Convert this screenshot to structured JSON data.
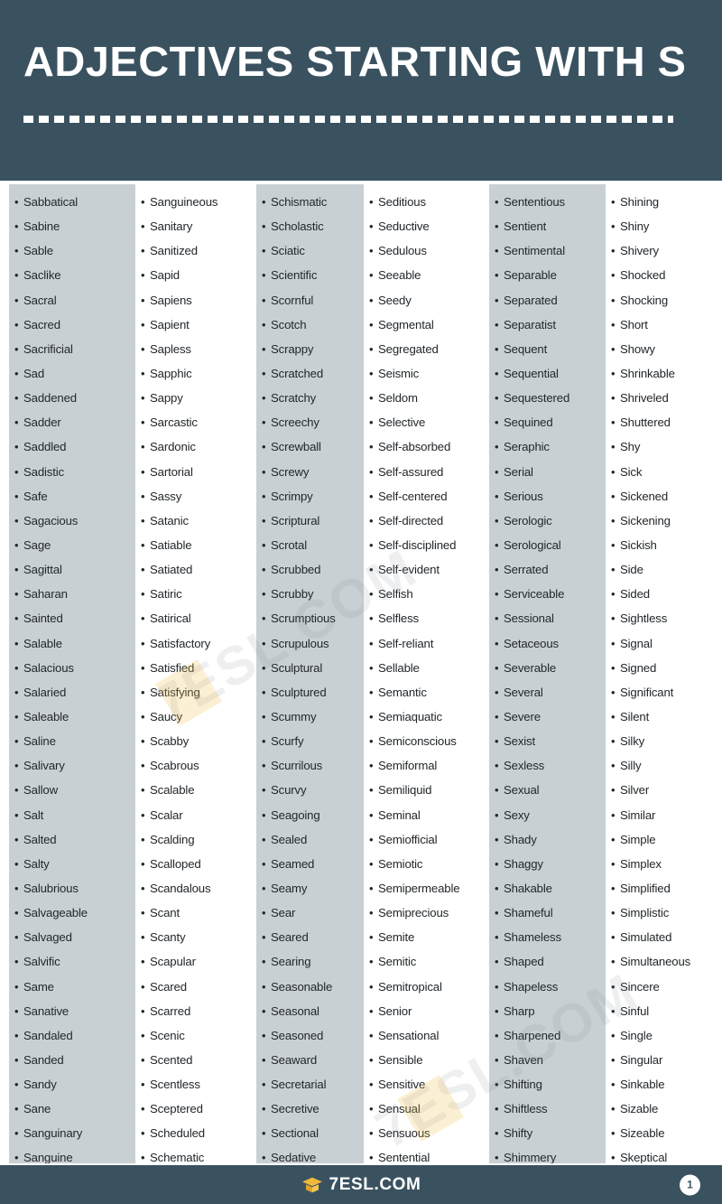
{
  "header": {
    "title": "ADJECTIVES STARTING WITH S",
    "divider": "dashed-rule",
    "background_color": "#3a5260",
    "text_color": "#ffffff"
  },
  "colors": {
    "header_bg": "#3a5260",
    "footer_bg": "#3a5260",
    "shaded_column_bg": "#c9d0d4",
    "plain_column_bg": "#ffffff",
    "word_text": "#22272b",
    "logo_accent": "#f0b93c"
  },
  "columns": [
    {
      "index": 1,
      "shaded": true,
      "words": [
        "Sabbatical",
        "Sabine",
        "Sable",
        "Saclike",
        "Sacral",
        "Sacred",
        "Sacrificial",
        "Sad",
        "Saddened",
        "Sadder",
        "Saddled",
        "Sadistic",
        "Safe",
        "Sagacious",
        "Sage",
        "Sagittal",
        "Saharan",
        "Sainted",
        "Salable",
        "Salacious",
        "Salaried",
        "Saleable",
        "Saline",
        "Salivary",
        "Sallow",
        "Salt",
        "Salted",
        "Salty",
        "Salubrious",
        "Salvageable",
        "Salvaged",
        "Salvific",
        "Same",
        "Sanative",
        "Sandaled",
        "Sanded",
        "Sandy",
        "Sane",
        "Sanguinary",
        "Sanguine"
      ]
    },
    {
      "index": 2,
      "shaded": false,
      "words": [
        "Sanguineous",
        "Sanitary",
        "Sanitized",
        "Sapid",
        "Sapiens",
        "Sapient",
        "Sapless",
        "Sapphic",
        "Sappy",
        "Sarcastic",
        "Sardonic",
        "Sartorial",
        "Sassy",
        "Satanic",
        "Satiable",
        "Satiated",
        "Satiric",
        "Satirical",
        "Satisfactory",
        "Satisfied",
        "Satisfying",
        "Saucy",
        "Scabby",
        "Scabrous",
        "Scalable",
        "Scalar",
        "Scalding",
        "Scalloped",
        "Scandalous",
        "Scant",
        "Scanty",
        "Scapular",
        "Scared",
        "Scarred",
        "Scenic",
        "Scented",
        "Scentless",
        "Sceptered",
        "Scheduled",
        "Schematic"
      ]
    },
    {
      "index": 3,
      "shaded": true,
      "words": [
        "Schismatic",
        "Scholastic",
        "Sciatic",
        "Scientific",
        "Scornful",
        "Scotch",
        "Scrappy",
        "Scratched",
        "Scratchy",
        "Screechy",
        "Screwball",
        "Screwy",
        "Scrimpy",
        "Scriptural",
        "Scrotal",
        "Scrubbed",
        "Scrubby",
        "Scrumptious",
        "Scrupulous",
        "Sculptural",
        "Sculptured",
        "Scummy",
        "Scurfy",
        "Scurrilous",
        "Scurvy",
        "Seagoing",
        "Sealed",
        "Seamed",
        "Seamy",
        "Sear",
        "Seared",
        "Searing",
        "Seasonable",
        "Seasonal",
        "Seasoned",
        "Seaward",
        "Secretarial",
        "Secretive",
        "Sectional",
        "Sedative"
      ]
    },
    {
      "index": 4,
      "shaded": false,
      "words": [
        "Seditious",
        "Seductive",
        "Sedulous",
        "Seeable",
        "Seedy",
        "Segmental",
        "Segregated",
        "Seismic",
        "Seldom",
        "Selective",
        "Self-absorbed",
        "Self-assured",
        "Self-centered",
        "Self-directed",
        "Self-disciplined",
        "Self-evident",
        "Selfish",
        "Selfless",
        "Self-reliant",
        "Sellable",
        "Semantic",
        "Semiaquatic",
        "Semiconscious",
        "Semiformal",
        "Semiliquid",
        "Seminal",
        "Semiofficial",
        "Semiotic",
        "Semipermeable",
        "Semiprecious",
        "Semite",
        "Semitic",
        "Semitropical",
        "Senior",
        "Sensational",
        "Sensible",
        "Sensitive",
        "Sensual",
        "Sensuous",
        "Sentential"
      ]
    },
    {
      "index": 5,
      "shaded": true,
      "words": [
        "Sententious",
        "Sentient",
        "Sentimental",
        "Separable",
        "Separated",
        "Separatist",
        "Sequent",
        "Sequential",
        "Sequestered",
        "Sequined",
        "Seraphic",
        "Serial",
        "Serious",
        "Serologic",
        "Serological",
        "Serrated",
        "Serviceable",
        "Sessional",
        "Setaceous",
        "Severable",
        "Several",
        "Severe",
        "Sexist",
        "Sexless",
        "Sexual",
        "Sexy",
        "Shady",
        "Shaggy",
        "Shakable",
        "Shameful",
        "Shameless",
        "Shaped",
        "Shapeless",
        "Sharp",
        "Sharpened",
        "Shaven",
        "Shifting",
        "Shiftless",
        "Shifty",
        "Shimmery"
      ]
    },
    {
      "index": 6,
      "shaded": false,
      "words": [
        "Shining",
        "Shiny",
        "Shivery",
        "Shocked",
        "Shocking",
        "Short",
        "Showy",
        "Shrinkable",
        "Shriveled",
        "Shuttered",
        "Shy",
        "Sick",
        "Sickened",
        "Sickening",
        "Sickish",
        "Side",
        "Sided",
        "Sightless",
        "Signal",
        "Signed",
        "Significant",
        "Silent",
        "Silky",
        "Silly",
        "Silver",
        "Similar",
        "Simple",
        "Simplex",
        "Simplified",
        "Simplistic",
        "Simulated",
        "Simultaneous",
        "Sincere",
        "Sinful",
        "Single",
        "Singular",
        "Sinkable",
        "Sizable",
        "Sizeable",
        "Skeptical"
      ]
    }
  ],
  "watermark": {
    "text": "7ESL.COM"
  },
  "footer": {
    "logo_icon": "graduation-cap-icon",
    "brand": "7ESL.COM",
    "page_number": "1"
  }
}
